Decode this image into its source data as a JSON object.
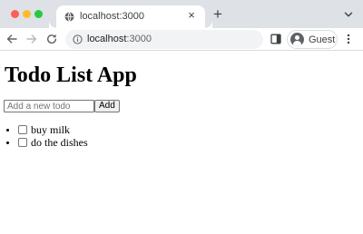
{
  "browser": {
    "tab": {
      "title": "localhost:3000",
      "favicon": "globe-icon",
      "close": "×"
    },
    "new_tab": "+",
    "address": {
      "host": "localhost",
      "port": ":3000"
    },
    "profile": {
      "name": "Guest"
    },
    "colors": {
      "tabstrip": "#dee1e6",
      "close": "#ff5f57",
      "minimize": "#febc2e",
      "zoom": "#28c840"
    }
  },
  "page": {
    "title": "Todo List App",
    "input": {
      "value": "",
      "placeholder": "Add a new todo"
    },
    "add_label": "Add",
    "todos": [
      {
        "text": "buy milk",
        "done": false
      },
      {
        "text": "do the dishes",
        "done": false
      }
    ]
  }
}
